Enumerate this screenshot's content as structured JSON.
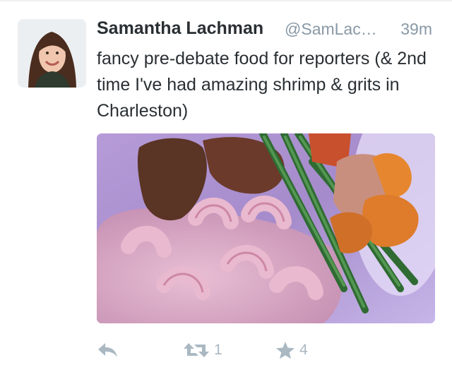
{
  "tweet": {
    "name": "Samantha Lachman",
    "handle": "@SamLac…",
    "time": "39m",
    "text": "fancy pre-debate food for reporters (& 2nd time I've had amazing shrimp & grits in Charleston)"
  },
  "actions": {
    "reply_icon": "reply-icon",
    "retweet_icon": "retweet-icon",
    "retweet_count": "1",
    "favorite_icon": "star-icon",
    "favorite_count": "4"
  },
  "colors": {
    "name": "#292f33",
    "secondary": "#8899a6",
    "action": "#aab8c2"
  }
}
